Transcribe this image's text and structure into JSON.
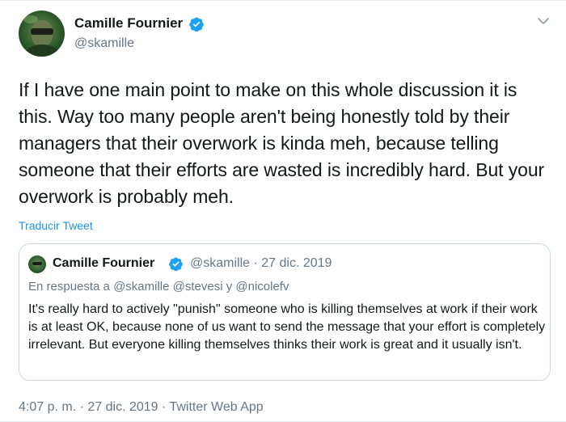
{
  "tweet": {
    "author": {
      "name": "Camille Fournier",
      "handle": "@skamille",
      "verified": true
    },
    "text": "If I have one main point to make on this whole discussion it is this. Way too many people aren't being honestly told by their managers that their overwork is kinda meh, because telling someone that their efforts are wasted is incredibly hard. But your overwork is probably meh.",
    "translate_label": "Traducir Tweet",
    "timestamp": "4:07 p. m. · 27 dic. 2019 · Twitter Web App"
  },
  "quoted_tweet": {
    "author": {
      "name": "Camille Fournier",
      "verified": true
    },
    "meta": "@skamille · 27 dic. 2019",
    "reply_line": "En respuesta a @skamille @stevesi y @nicolefv",
    "text": "It's really hard to actively \"punish\" someone who is killing themselves at work if their work is at least OK, because none of us want to send the message that your effort is completely irrelevant. But everyone killing themselves thinks their work is great and it usually isn't."
  },
  "colors": {
    "accent": "#1da1f2",
    "link": "#1b95e0",
    "muted": "#657786",
    "text": "#14171a",
    "border": "#ccd6dd"
  },
  "icons": {
    "verified": "verified-badge-icon",
    "caret": "chevron-down-icon"
  }
}
